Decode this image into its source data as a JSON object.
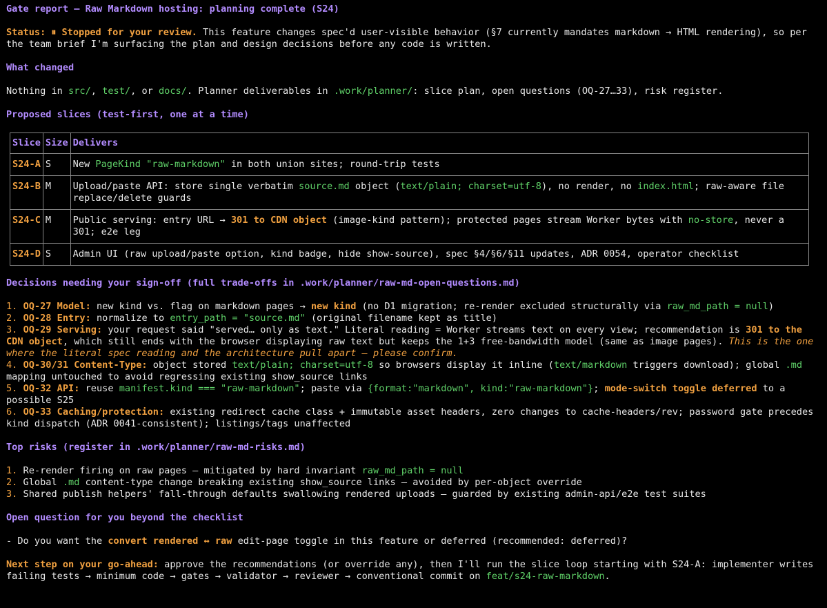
{
  "title": "Gate report — Raw Markdown hosting: planning complete (S24)",
  "status": {
    "label": "Status: ⏸ Stopped for your review.",
    "text": " This feature changes spec'd user-visible behavior (§7 currently mandates markdown → HTML rendering), so per the team brief I'm surfacing the plan and design decisions before any code is written."
  },
  "what_changed": {
    "heading": "What changed",
    "t1": "Nothing in ",
    "c1": "src/",
    "t2": ", ",
    "c2": "test/",
    "t3": ", or ",
    "c3": "docs/",
    "t4": ". Planner deliverables in ",
    "c4": ".work/planner/",
    "t5": ": slice plan, open questions (OQ-27…33), risk register."
  },
  "slices": {
    "heading": "Proposed slices (test-first, one at a time)",
    "headers": [
      "Slice",
      "Size",
      "Delivers"
    ],
    "rows": [
      {
        "id": "S24-A",
        "size": "S",
        "a": "New ",
        "b": "PageKind \"raw-markdown\"",
        "c": " in both union sites; round-trip tests",
        "d": "",
        "e": "",
        "f": "",
        "g": ""
      },
      {
        "id": "S24-B",
        "size": "M",
        "a": "Upload/paste API: store single verbatim ",
        "b": "source.md",
        "c": " object (",
        "d": "text/plain; charset=utf-8",
        "e": "), no render, no ",
        "f": "index.html",
        "g": "; raw-aware file replace/delete guards"
      },
      {
        "id": "S24-C",
        "size": "M",
        "a": "Public serving: entry URL → ",
        "b": "301 to CDN object",
        "c": " (image-kind pattern); protected pages stream Worker bytes with ",
        "d": "no-store",
        "e": ", never a 301; e2e leg",
        "f": "",
        "g": ""
      },
      {
        "id": "S24-D",
        "size": "S",
        "a": "Admin UI (raw upload/paste option, kind badge, hide show-source), spec §4/§6/§11 updates, ADR 0054, operator checklist",
        "b": "",
        "c": "",
        "d": "",
        "e": "",
        "f": "",
        "g": ""
      }
    ]
  },
  "decisions": {
    "heading": "Decisions needing your sign-off (full trade-offs in .work/planner/raw-md-open-questions.md)",
    "items": [
      {
        "n": "1.",
        "k": "OQ-27 Model:",
        "a": " new kind vs. flag on markdown pages → ",
        "b": "new kind",
        "c": " (no D1 migration; re-render excluded structurally via ",
        "d": "raw_md_path = null",
        "e": ")",
        "f": "",
        "g": "",
        "h": ""
      },
      {
        "n": "2.",
        "k": "OQ-28 Entry:",
        "a": " normalize to ",
        "b": "entry_path = \"source.md\"",
        "c": " (original filename kept as title)",
        "d": "",
        "e": "",
        "f": "",
        "g": "",
        "h": ""
      },
      {
        "n": "3.",
        "k": "OQ-29 Serving:",
        "a": " your request said \"served… only as text.\" Literal reading = Worker streams text on every view; recommendation is ",
        "b": "301 to the CDN object",
        "c": ", which still ends with the browser displaying raw text but keeps the 1+3 free-bandwidth model (same as image pages). ",
        "d": "This is the one where the literal spec reading and the architecture pull apart — please confirm.",
        "e": "",
        "f": "",
        "g": "",
        "h": ""
      },
      {
        "n": "4.",
        "k": "OQ-30/31 Content-Type:",
        "a": " object stored ",
        "b": "text/plain; charset=utf-8",
        "c": " so browsers display it inline (",
        "d": "text/markdown",
        "e": " triggers download); global ",
        "f": ".md",
        "g": " mapping untouched to avoid regressing existing show_source links",
        "h": ""
      },
      {
        "n": "5.",
        "k": "OQ-32 API:",
        "a": " reuse ",
        "b": "manifest.kind === \"raw-markdown\"",
        "c": "; paste via ",
        "d": "{format:\"markdown\", kind:\"raw-markdown\"}",
        "e": "; ",
        "f": "mode-switch toggle deferred",
        "g": " to a possible S25",
        "h": ""
      },
      {
        "n": "6.",
        "k": "OQ-33 Caching/protection:",
        "a": " existing redirect cache class + immutable asset headers, zero changes to cache-headers/rev; password gate precedes kind dispatch (ADR 0041-consistent); listings/tags unaffected",
        "b": "",
        "c": "",
        "d": "",
        "e": "",
        "f": "",
        "g": "",
        "h": ""
      }
    ]
  },
  "risks": {
    "heading": "Top risks (register in .work/planner/raw-md-risks.md)",
    "items": [
      {
        "n": "1.",
        "a": " Re-render firing on raw pages — mitigated by hard invariant ",
        "b": "raw_md_path = null",
        "c": ""
      },
      {
        "n": "2.",
        "a": " Global ",
        "b": ".md",
        "c": " content-type change breaking existing show_source links — avoided by per-object override"
      },
      {
        "n": "3.",
        "a": " Shared publish helpers' fall-through defaults swallowing rendered uploads — guarded by existing admin-api/e2e test suites",
        "b": "",
        "c": ""
      }
    ]
  },
  "open_question": {
    "heading": "Open question for you beyond the checklist",
    "a": "- Do you want the ",
    "b": "convert rendered ↔ raw",
    "c": " edit-page toggle in this feature or deferred (recommended: deferred)?"
  },
  "next_step": {
    "label": "Next step on your go-ahead:",
    "a": " approve the recommendations (or override any), then I'll run the slice loop starting with S24-A: implementer writes failing tests → minimum code → gates → validator → reviewer → conventional commit on ",
    "b": "feat/s24-raw-markdown",
    "c": "."
  }
}
